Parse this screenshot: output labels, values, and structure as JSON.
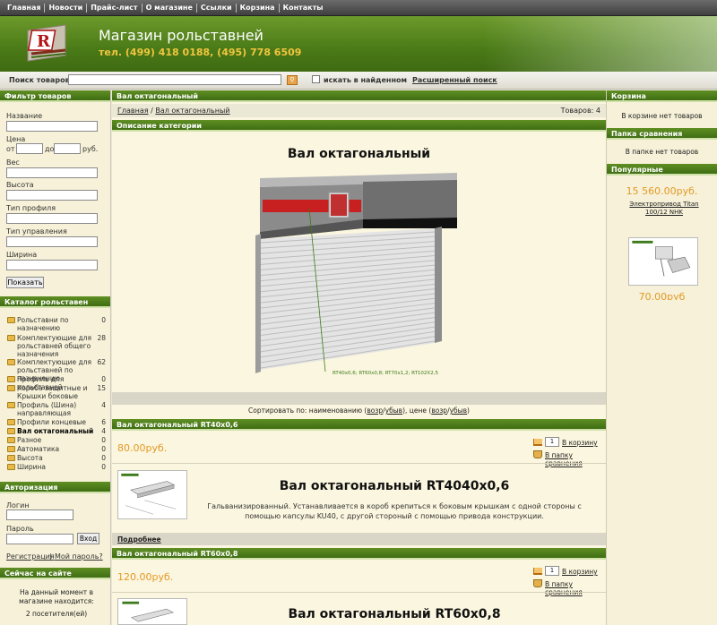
{
  "nav": [
    "Главная",
    "Новости",
    "Прайс-лист",
    "О магазине",
    "Ссылки",
    "Корзина",
    "Контакты"
  ],
  "header": {
    "title": "Магазин рольставней",
    "phone": "тел. (499) 418 0188, (495) 778 6509",
    "logo_letter": "R"
  },
  "search": {
    "label": "Поиск товаров",
    "value": "",
    "in_found": "искать в найденном",
    "advanced": "Расширенный поиск"
  },
  "filter": {
    "title": "Фильтр товаров",
    "name": "Название",
    "price": "Цена",
    "from": "от",
    "to": "до",
    "currency": "руб.",
    "weight": "Вес",
    "height": "Высота",
    "profile_type": "Тип профиля",
    "control_type": "Тип управления",
    "width": "Ширина",
    "show_button": "Показать"
  },
  "catalog": {
    "title": "Каталог рольставен",
    "items": [
      {
        "name": "Рольставни по назначению",
        "count": "0"
      },
      {
        "name": "Комплектующие для рольставней общего назначения",
        "count": "28"
      },
      {
        "name": "Комплектующие для рольставней по назначению",
        "count": "62"
      },
      {
        "name": "Профиль для рольставней",
        "count": "0"
      },
      {
        "name": "Короба защитные и Крышки боковые",
        "count": "15"
      },
      {
        "name": "Профиль (Шина) направляющая",
        "count": "4"
      },
      {
        "name": "Профили концевые",
        "count": "6"
      },
      {
        "name": "Вал октагональный",
        "count": "4"
      },
      {
        "name": "Разное",
        "count": "0"
      },
      {
        "name": "Автоматика",
        "count": "0"
      },
      {
        "name": "Высота",
        "count": "0"
      },
      {
        "name": "Ширина",
        "count": "0"
      }
    ]
  },
  "auth": {
    "title": "Авторизация",
    "login": "Логин",
    "password": "Пароль",
    "enter": "Вход",
    "register": "Регистрация",
    "forgot": "Мой пароль?"
  },
  "online": {
    "title": "Сейчас на сайте",
    "text": "На данный момент в магазине находится:",
    "count": "2 посетителя(ей)"
  },
  "main": {
    "title": "Вал октагональный",
    "breadcrumb_home": "Главная",
    "breadcrumb_current": "Вал октагональный",
    "goods_count": "Товаров: 4",
    "category_desc_title": "Описание категории",
    "category_heading": "Вал октагональный",
    "image_caption": "RT40x0,6; RT60x0,8; RT70x1,2; RT102X2,5",
    "sort_prefix": "Сортировать по: наименованию (",
    "sort_asc": "возр",
    "sort_sep": "/",
    "sort_desc": "убыв",
    "sort_mid": "), цене (",
    "sort_end": ")",
    "add_to_cart": "В корзину",
    "add_to_compare": "В папку сравнения",
    "more": "Подробнее",
    "products": [
      {
        "bar": "Вал октагональный RT40x0,6",
        "price": "80.00руб.",
        "qty": "1",
        "title": "Вал октагональный RT4040x0,6",
        "desc": "Гальванизированный. Устанавливается в короб крепиться к боковым крышкам с одной стороны с помощью капсулы KU40, с другой стороный с помощью привода конструкции."
      },
      {
        "bar": "Вал октагональный RT60x0,8",
        "price": "120.00руб.",
        "qty": "1",
        "title": "Вал октагональный RT60x0,8",
        "desc": ""
      }
    ]
  },
  "cart": {
    "title": "Корзина",
    "empty": "В корзине нет товаров"
  },
  "compare": {
    "title": "Папка сравнения",
    "empty": "В папке нет товаров"
  },
  "popular": {
    "title": "Популярные",
    "price1": "15 560.00руб.",
    "name1": "Электропривод Titan 100/12 NHK",
    "price2": "70.00руб"
  }
}
